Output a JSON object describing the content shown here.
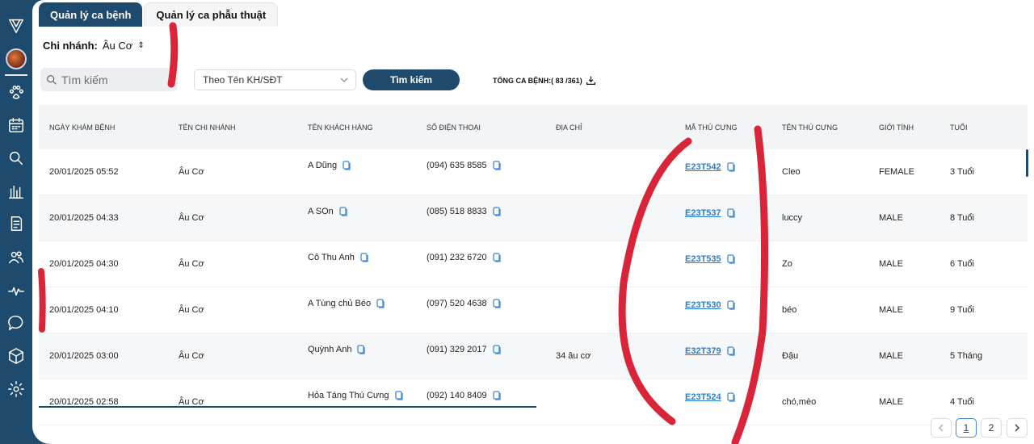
{
  "tabs": [
    {
      "label": "Quản lý ca bệnh"
    },
    {
      "label": "Quản lý ca phẫu thuật"
    }
  ],
  "branch": {
    "label": "Chi nhánh:",
    "value": "Âu Cơ"
  },
  "search": {
    "placeholder": "Tìm kiếm"
  },
  "filter": {
    "selected": "Theo Tên KH/SĐT"
  },
  "search_button": "Tìm kiếm",
  "total": {
    "label": "TỔNG CA BỆNH:( 83 /361)"
  },
  "table": {
    "headers": [
      "NGÀY KHÁM BỆNH",
      "TÊN CHI NHÁNH",
      "TÊN KHÁCH HÀNG",
      "SỐ ĐIỆN THOẠI",
      "ĐỊA CHỈ",
      "MÃ THÚ CƯNG",
      "TÊN THÚ CƯNG",
      "GIỚI TÍNH",
      "TUỔI"
    ],
    "rows": [
      {
        "date": "20/01/2025 05:52",
        "branch": "Âu Cơ",
        "customer": "A Dũng",
        "phone": "(094) 635 8585",
        "address": "",
        "pet_code": "E23T542",
        "pet_name": "Cleo",
        "gender": "FEMALE",
        "age": "3 Tuổi"
      },
      {
        "date": "20/01/2025 04:33",
        "branch": "Âu Cơ",
        "customer": "A SOn",
        "phone": "(085) 518 8833",
        "address": "",
        "pet_code": "E23T537",
        "pet_name": "luccy",
        "gender": "MALE",
        "age": "8 Tuổi"
      },
      {
        "date": "20/01/2025 04:30",
        "branch": "Âu Cơ",
        "customer": "Cô Thu Anh",
        "phone": "(091) 232 6720",
        "address": "",
        "pet_code": "E23T535",
        "pet_name": "Zo",
        "gender": "MALE",
        "age": "6 Tuổi"
      },
      {
        "date": "20/01/2025 04:10",
        "branch": "Âu Cơ",
        "customer": "A Tùng chủ Béo",
        "phone": "(097) 520 4638",
        "address": "",
        "pet_code": "E23T530",
        "pet_name": "béo",
        "gender": "MALE",
        "age": "9 Tuổi"
      },
      {
        "date": "20/01/2025 03:00",
        "branch": "Âu Cơ",
        "customer": "Quỳnh Anh",
        "phone": "(091) 329 2017",
        "address": "34 âu cơ",
        "pet_code": "E32T379",
        "pet_name": "Đậu",
        "gender": "MALE",
        "age": "5 Tháng"
      },
      {
        "date": "20/01/2025 02:58",
        "branch": "Âu Cơ",
        "customer": "Hỏa Táng Thú Cưng",
        "phone": "(092) 140 8409",
        "address": "",
        "pet_code": "E23T524",
        "pet_name": "chó,mèo",
        "gender": "MALE",
        "age": "4 Tuổi"
      }
    ]
  },
  "pagination": {
    "pages": [
      "1",
      "2"
    ],
    "current": "1"
  },
  "colors": {
    "primary": "#1e4a6e",
    "link": "#2b7fd1",
    "annotation": "#d8253a"
  }
}
